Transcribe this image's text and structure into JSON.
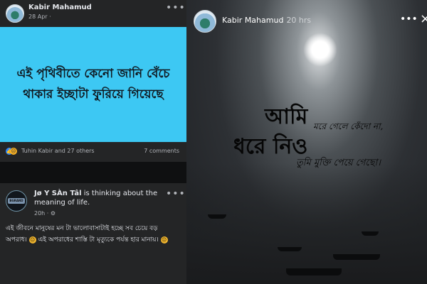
{
  "post1": {
    "author": "Kabir Mahamud",
    "date": "28 Apr ·",
    "text": "এই পৃথিবীতে কেনো জানি বেঁচে থাকার ইচ্ছাটা ফুরিয়ে গিয়েছে",
    "reactions": "Tuhin Kabir and 27 others",
    "comments": "7 comments",
    "banner_color": "#3dc8f3"
  },
  "post2": {
    "author": "Jø Y SÀn Tâl",
    "activity": " is thinking about the meaning of life.",
    "time": "20h · ⚙",
    "avatar_badge": "BGRAND",
    "text_part1": "এই জীবনে মানুষের মন টা ভালোবাসাটাই হচ্ছে সব চেয়ে বড় অপরাধ।",
    "text_part2": " এই অপরাধের শাস্তি টা মৃত্যুকে পর্যন্ত হার মানায়।",
    "emoji1": "😔",
    "emoji2": "😔"
  },
  "story": {
    "author": "Kabir Mahamud",
    "time": "20 hrs",
    "close_label": "×",
    "line1_big": "আমি",
    "line1_small": "মরে গেলে কেঁদো না,",
    "line2_big": "ধরে নিও",
    "line2_small": "তুমি মুক্তি পেয়ে গেছো।"
  },
  "icons": {
    "more": "more-icon",
    "like": "like-reaction-icon",
    "sad": "sad-reaction-icon",
    "close": "close-icon"
  }
}
